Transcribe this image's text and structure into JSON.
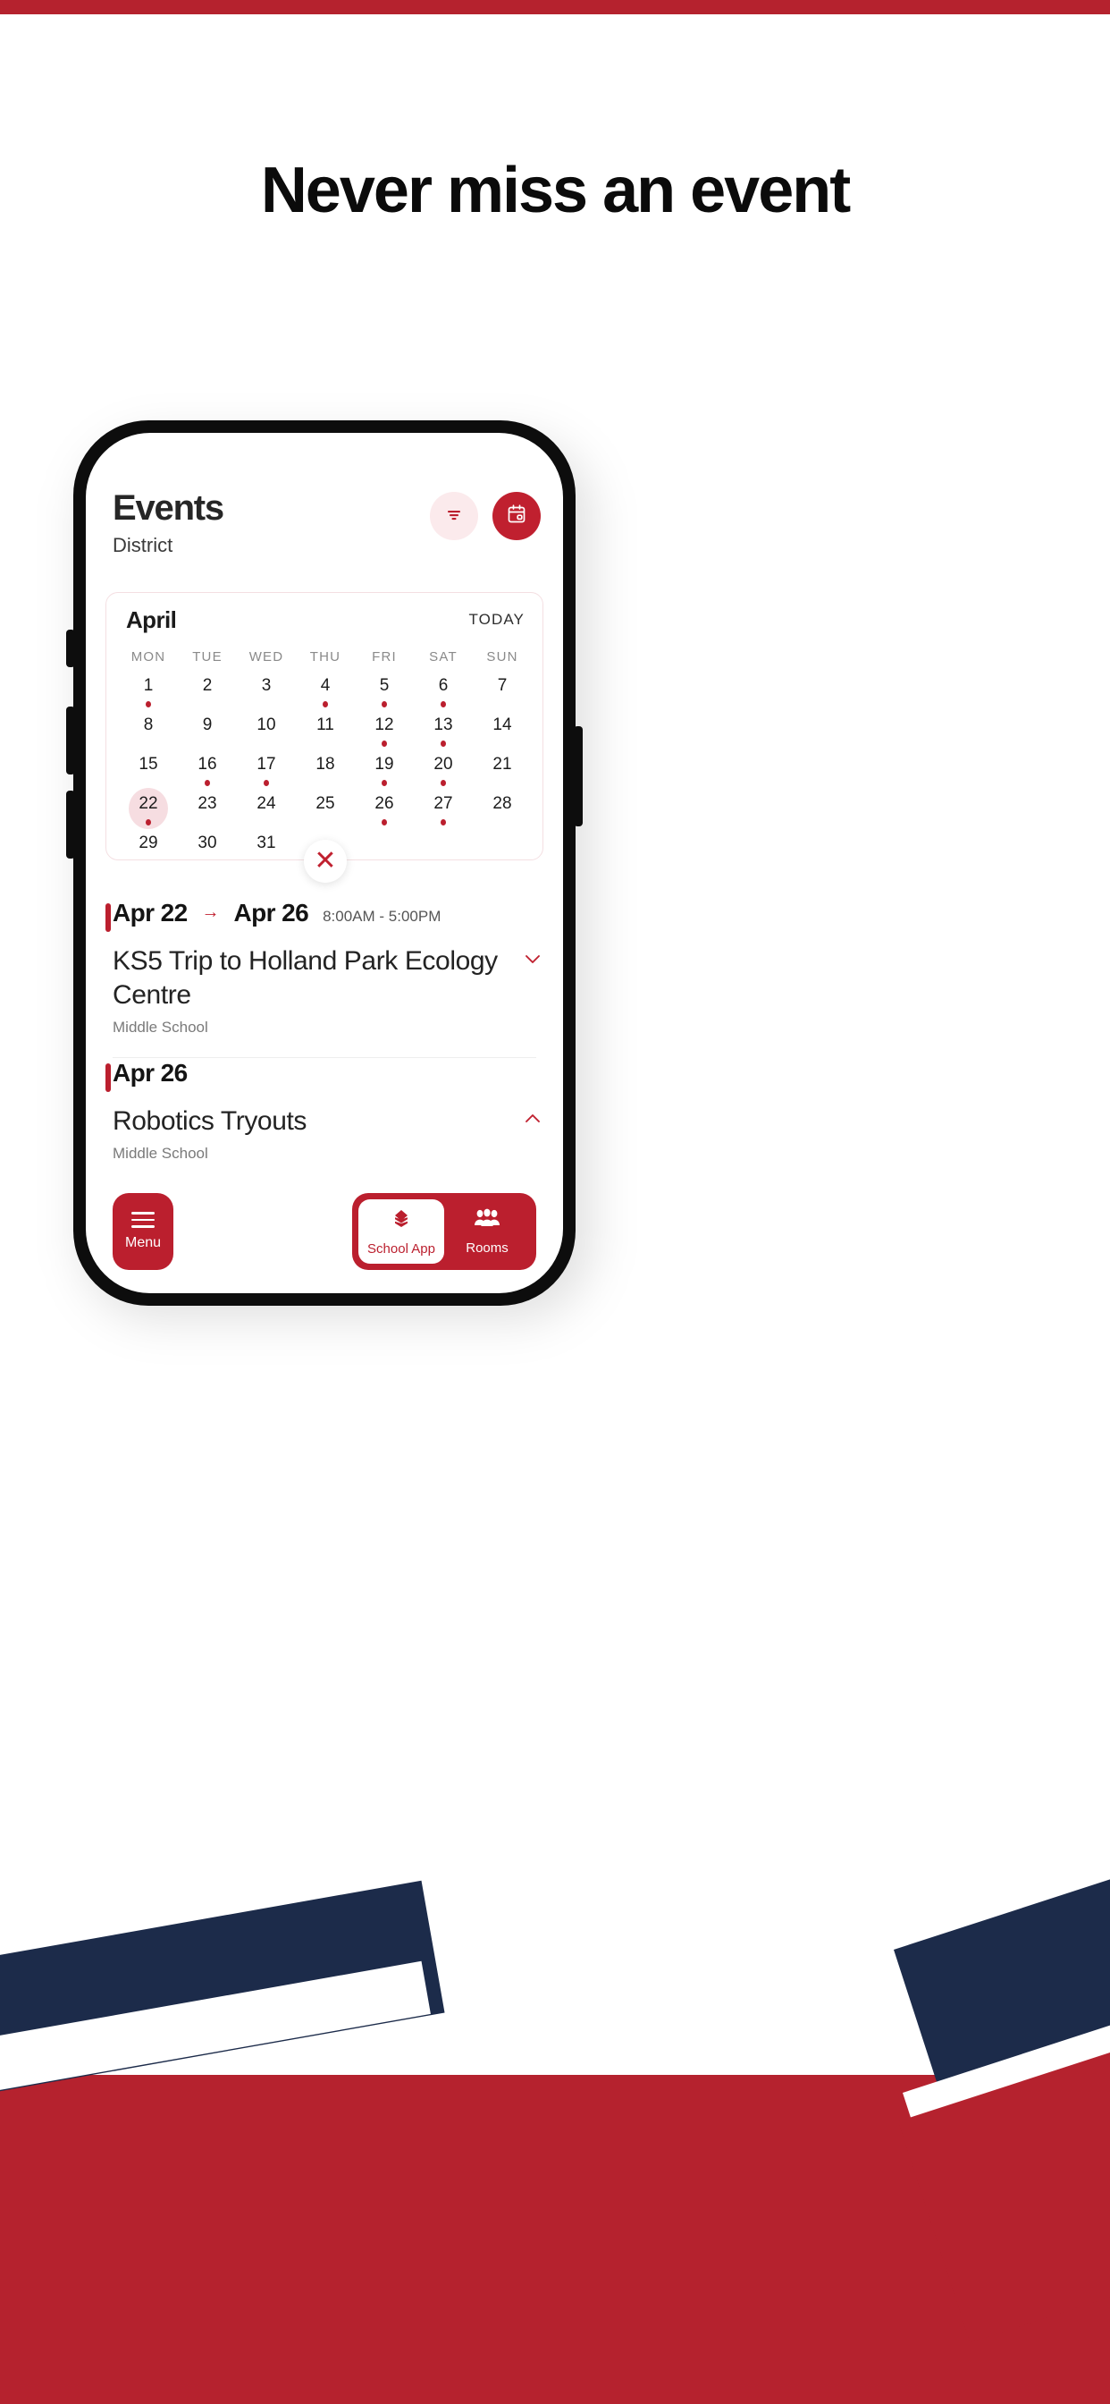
{
  "promo": {
    "headline": "Never miss an event",
    "accent_color": "#b5222e",
    "navy_color": "#1c2b4a"
  },
  "app": {
    "header": {
      "title": "Events",
      "subtitle": "District",
      "filter_icon": "filter-icon",
      "calendar_icon": "calendar-icon"
    },
    "calendar": {
      "month": "April",
      "today_label": "TODAY",
      "day_headers": [
        "MON",
        "TUE",
        "WED",
        "THU",
        "FRI",
        "SAT",
        "SUN"
      ],
      "leading_blanks": 0,
      "days": [
        {
          "n": "1",
          "dot": true,
          "selected": false
        },
        {
          "n": "2",
          "dot": false,
          "selected": false
        },
        {
          "n": "3",
          "dot": false,
          "selected": false
        },
        {
          "n": "4",
          "dot": true,
          "selected": false
        },
        {
          "n": "5",
          "dot": true,
          "selected": false
        },
        {
          "n": "6",
          "dot": true,
          "selected": false
        },
        {
          "n": "7",
          "dot": false,
          "selected": false
        },
        {
          "n": "8",
          "dot": false,
          "selected": false
        },
        {
          "n": "9",
          "dot": false,
          "selected": false
        },
        {
          "n": "10",
          "dot": false,
          "selected": false
        },
        {
          "n": "11",
          "dot": false,
          "selected": false
        },
        {
          "n": "12",
          "dot": true,
          "selected": false
        },
        {
          "n": "13",
          "dot": true,
          "selected": false
        },
        {
          "n": "14",
          "dot": false,
          "selected": false
        },
        {
          "n": "15",
          "dot": false,
          "selected": false
        },
        {
          "n": "16",
          "dot": true,
          "selected": false
        },
        {
          "n": "17",
          "dot": true,
          "selected": false
        },
        {
          "n": "18",
          "dot": false,
          "selected": false
        },
        {
          "n": "19",
          "dot": true,
          "selected": false
        },
        {
          "n": "20",
          "dot": true,
          "selected": false
        },
        {
          "n": "21",
          "dot": false,
          "selected": false
        },
        {
          "n": "22",
          "dot": true,
          "selected": true
        },
        {
          "n": "23",
          "dot": false,
          "selected": false
        },
        {
          "n": "24",
          "dot": false,
          "selected": false
        },
        {
          "n": "25",
          "dot": false,
          "selected": false
        },
        {
          "n": "26",
          "dot": true,
          "selected": false
        },
        {
          "n": "27",
          "dot": true,
          "selected": false
        },
        {
          "n": "28",
          "dot": false,
          "selected": false
        },
        {
          "n": "29",
          "dot": false,
          "selected": false
        },
        {
          "n": "30",
          "dot": false,
          "selected": false
        },
        {
          "n": "31",
          "dot": false,
          "selected": false
        }
      ],
      "close_label": "✕",
      "dot_color": "#bb1f2e",
      "selected_bg": "#f6dde1"
    },
    "events": [
      {
        "start_date": "Apr 22",
        "arrow": "→",
        "end_date": "Apr 26",
        "time": "8:00AM  -  5:00PM",
        "title": "KS5 Trip to Holland Park Ecology Centre",
        "subtitle": "Middle School",
        "chevron": "chevron-down-icon",
        "expanded": false
      },
      {
        "start_date": "Apr 26",
        "arrow": "",
        "end_date": "",
        "time": "",
        "title": "Robotics Tryouts",
        "subtitle": "Middle School",
        "chevron": "chevron-up-icon",
        "expanded": true
      }
    ],
    "bottom_nav": {
      "menu_label": "Menu",
      "menu_icon": "hamburger-icon",
      "items": [
        {
          "label": "School App",
          "icon": "layers-icon",
          "active": true
        },
        {
          "label": "Rooms",
          "icon": "people-icon",
          "active": false
        }
      ]
    }
  }
}
